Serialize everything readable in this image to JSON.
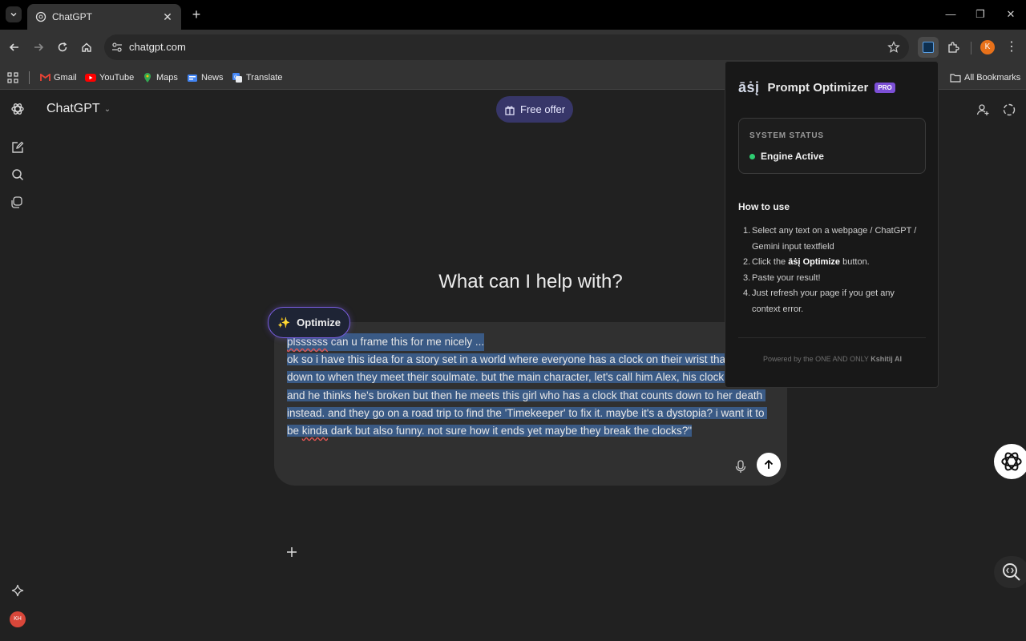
{
  "browser": {
    "tab": {
      "title": "ChatGPT"
    },
    "url": "chatgpt.com",
    "profile_initial": "K",
    "bookmarks": [
      {
        "label": "Gmail",
        "icon": "gmail-icon",
        "color": "#ea4335"
      },
      {
        "label": "YouTube",
        "icon": "youtube-icon",
        "color": "#ff0000"
      },
      {
        "label": "Maps",
        "icon": "maps-icon",
        "color": "#34a853"
      },
      {
        "label": "News",
        "icon": "news-icon",
        "color": "#4285f4"
      },
      {
        "label": "Translate",
        "icon": "translate-icon",
        "color": "#4285f4"
      }
    ],
    "all_bookmarks": "All Bookmarks"
  },
  "chatgpt": {
    "model": "ChatGPT",
    "free_offer": "Free offer",
    "hero": "What can I help with?",
    "user_avatar": "KH",
    "composer": {
      "line1_word": "plssssss",
      "line1_rest": " can u frame this for me nicely ...",
      "body_before_kinda": "ok so i have this idea for a story set in a world where everyone has a clock on their wrist that counts down to when they meet their soulmate. but the main character, let's call him Alex, his clock is blank? and he thinks he's broken but then he meets this girl who has a clock that counts down to her death instead. and they go on a road trip to find the 'Timekeeper' to fix it. maybe it's a dystopia? i want it to be ",
      "kinda": "kinda",
      "body_after_kinda": " dark but also funny. not sure how it ends yet maybe they break the clocks?\""
    },
    "optimize_button": "Optimize"
  },
  "popup": {
    "logo": "āṡį",
    "title": "Prompt Optimizer",
    "badge": "PRO",
    "status_label": "SYSTEM STATUS",
    "status_value": "Engine Active",
    "status_color": "#2ecc71",
    "howto_title": "How to use",
    "steps": [
      {
        "num": "1.",
        "text": "Select any text on a webpage / ChatGPT / Gemini input textfield"
      },
      {
        "num": "2.",
        "pre": "Click the ",
        "bold": "āṡį Optimize",
        "post": " button."
      },
      {
        "num": "3.",
        "text": "Paste your result!"
      },
      {
        "num": "4.",
        "text": "Just refresh your page if you get any context error."
      }
    ],
    "footer_pre": "Powered by the ONE AND ONLY ",
    "footer_bold": "Kshitij AI"
  }
}
